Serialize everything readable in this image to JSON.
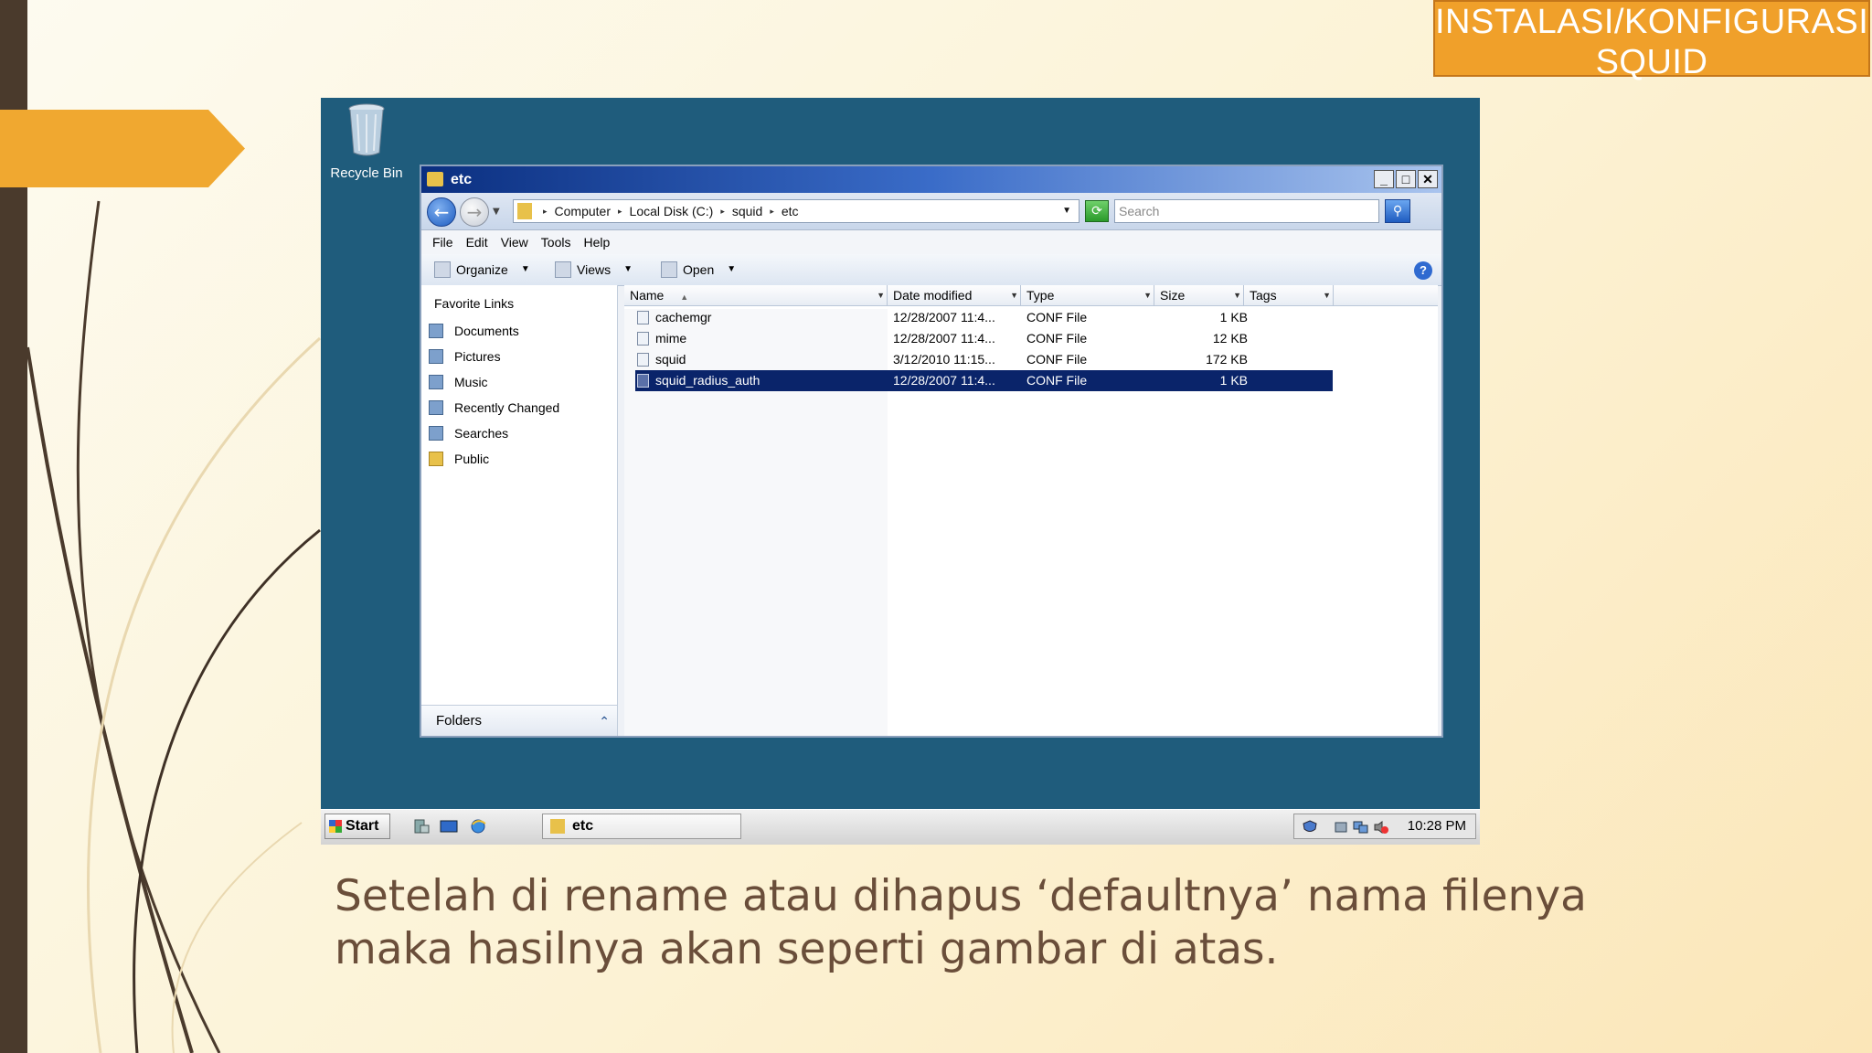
{
  "slide": {
    "title": "INSTALASI/KONFIGURASI SQUID",
    "caption_line1": "Setelah di rename atau dihapus ‘defaultnya’ nama filenya",
    "caption_line2": "maka hasilnya akan seperti gambar di atas.",
    "accent_color": "#f0a830",
    "bar_color": "#4a3a2c"
  },
  "desktop": {
    "recycle_bin_label": "Recycle Bin",
    "background_color": "#1f5c7c"
  },
  "window": {
    "title": "etc",
    "controls": {
      "minimize": "_",
      "maximize": "□",
      "close": "✕"
    },
    "address": {
      "crumbs": [
        "Computer",
        "Local Disk (C:)",
        "squid",
        "etc"
      ]
    },
    "search": {
      "placeholder": "Search"
    },
    "menu": [
      "File",
      "Edit",
      "View",
      "Tools",
      "Help"
    ],
    "toolbar": {
      "organize": "Organize",
      "views": "Views",
      "open": "Open"
    },
    "nav": {
      "header": "Favorite Links",
      "items": [
        {
          "label": "Documents",
          "icon": "documents-icon"
        },
        {
          "label": "Pictures",
          "icon": "pictures-icon"
        },
        {
          "label": "Music",
          "icon": "music-icon"
        },
        {
          "label": "Recently Changed",
          "icon": "recently-changed-icon"
        },
        {
          "label": "Searches",
          "icon": "searches-icon"
        },
        {
          "label": "Public",
          "icon": "folder-icon"
        }
      ],
      "folders_label": "Folders"
    },
    "columns": [
      "Name",
      "Date modified",
      "Type",
      "Size",
      "Tags"
    ],
    "files": [
      {
        "name": "cachemgr",
        "date": "12/28/2007 11:4...",
        "type": "CONF File",
        "size": "1 KB",
        "selected": false
      },
      {
        "name": "mime",
        "date": "12/28/2007 11:4...",
        "type": "CONF File",
        "size": "12 KB",
        "selected": false
      },
      {
        "name": "squid",
        "date": "3/12/2010 11:15...",
        "type": "CONF File",
        "size": "172 KB",
        "selected": false
      },
      {
        "name": "squid_radius_auth",
        "date": "12/28/2007 11:4...",
        "type": "CONF File",
        "size": "1 KB",
        "selected": true
      }
    ]
  },
  "taskbar": {
    "start_label": "Start",
    "task_label": "etc",
    "clock": "10:28 PM"
  }
}
